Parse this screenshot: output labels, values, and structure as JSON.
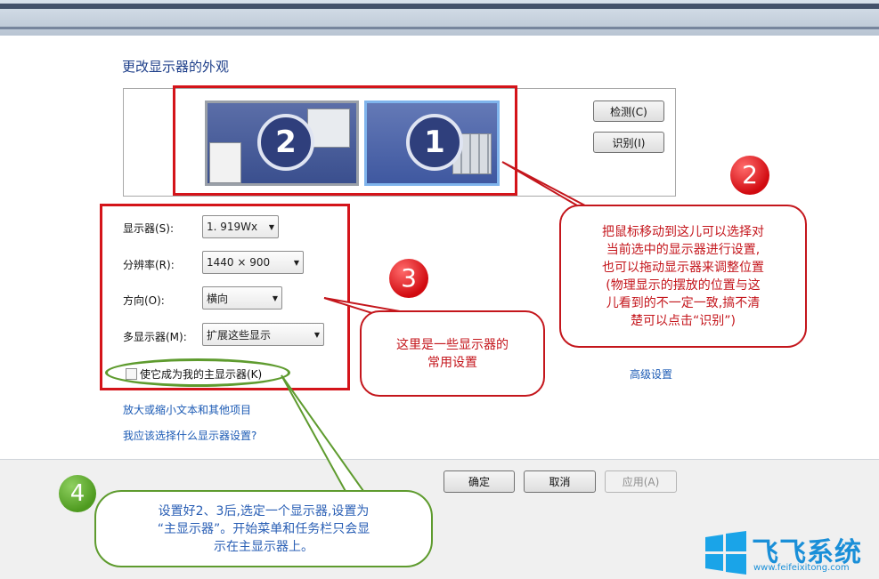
{
  "page_title": "更改显示器的外观",
  "monitors": [
    {
      "number": "1",
      "selected": true
    },
    {
      "number": "2",
      "selected": false
    }
  ],
  "buttons": {
    "detect": "检测(C)",
    "identify": "识别(I)",
    "ok": "确定",
    "cancel": "取消",
    "apply": "应用(A)"
  },
  "settings": {
    "display_label": "显示器(S):",
    "display_value": "1. 919Wx",
    "resolution_label": "分辨率(R):",
    "resolution_value": "1440 × 900",
    "orientation_label": "方向(O):",
    "orientation_value": "横向",
    "multi_label": "多显示器(M):",
    "multi_value": "扩展这些显示",
    "primary_checkbox": "使它成为我的主显示器(K)",
    "primary_checked": false
  },
  "links": {
    "advanced": "高级设置",
    "text_size": "放大或缩小文本和其他项目",
    "which_settings": "我应该选择什么显示器设置?"
  },
  "annotations": {
    "step2_number": "2",
    "step2_text": [
      "把鼠标移动到这儿可以选择对",
      "当前选中的显示器进行设置,",
      "也可以拖动显示器来调整位置",
      "(物理显示的摆放的位置与这",
      "儿看到的不一定一致,搞不清",
      "楚可以点击“识别”)"
    ],
    "step3_number": "3",
    "step3_text": [
      "这里是一些显示器的",
      "常用设置"
    ],
    "step4_number": "4",
    "step4_text": [
      "设置好2、3后,选定一个显示器,设置为",
      "“主显示器”。开始菜单和任务栏只会显",
      "示在主显示器上。"
    ]
  },
  "watermark": {
    "brand": "飞飞系统",
    "url": "www.feifeixitong.com"
  },
  "colors": {
    "annotation_red": "#d4141a",
    "annotation_green": "#5e9b2e",
    "link_blue": "#1c5bb5",
    "title_blue": "#1e3f8a"
  }
}
